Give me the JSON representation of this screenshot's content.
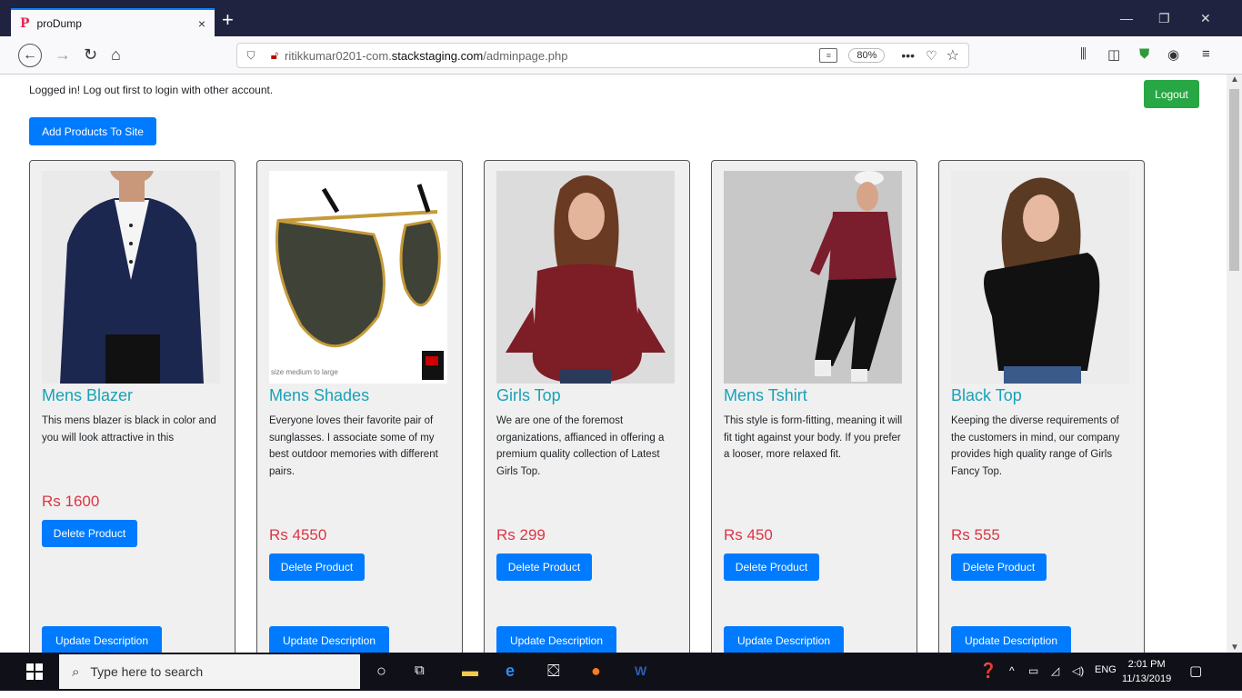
{
  "browser": {
    "tab_title": "proDump",
    "tab_close": "×",
    "new_tab": "+",
    "url_plain": "ritikkumar0201-com.",
    "url_host": "stackstaging.com",
    "url_path": "/adminpage.php",
    "zoom": "80%",
    "more": "•••",
    "minimize": "—",
    "restore": "❐",
    "close": "✕"
  },
  "page": {
    "logged_message": "Logged in! Log out first to login with other account.",
    "logout_label": "Logout",
    "add_products_label": "Add Products To Site"
  },
  "products": [
    {
      "name": "Mens Blazer",
      "description": "This mens blazer is black in color and you will look attractive in this",
      "price": "Rs 1600",
      "delete_label": "Delete Product",
      "update_label": "Update Description"
    },
    {
      "name": "Mens Shades",
      "description": "Everyone loves their favorite pair of sunglasses. I associate some of my best outdoor memories with different pairs.",
      "price": "Rs 4550",
      "delete_label": "Delete Product",
      "update_label": "Update Description",
      "image_caption": "size medium to large"
    },
    {
      "name": "Girls Top",
      "description": "We are one of the foremost organizations, affianced in offering a premium quality collection of Latest Girls Top.",
      "price": "Rs 299",
      "delete_label": "Delete Product",
      "update_label": "Update Description"
    },
    {
      "name": "Mens Tshirt",
      "description": "This style is form-fitting, meaning it will fit tight against your body. If you prefer a looser, more relaxed fit.",
      "price": "Rs 450",
      "delete_label": "Delete Product",
      "update_label": "Update Description"
    },
    {
      "name": "Black Top",
      "description": "Keeping the diverse requirements of the customers in mind, our company provides high quality range of Girls Fancy Top.",
      "price": "Rs 555",
      "delete_label": "Delete Product",
      "update_label": "Update Description"
    }
  ],
  "taskbar": {
    "search_placeholder": "Type here to search",
    "language": "ENG",
    "time": "2:01 PM",
    "date": "11/13/2019"
  },
  "colors": {
    "accent_blue": "#007bff",
    "logout_green": "#28a745",
    "product_name": "#17a2b8",
    "price_red": "#dc3545"
  }
}
